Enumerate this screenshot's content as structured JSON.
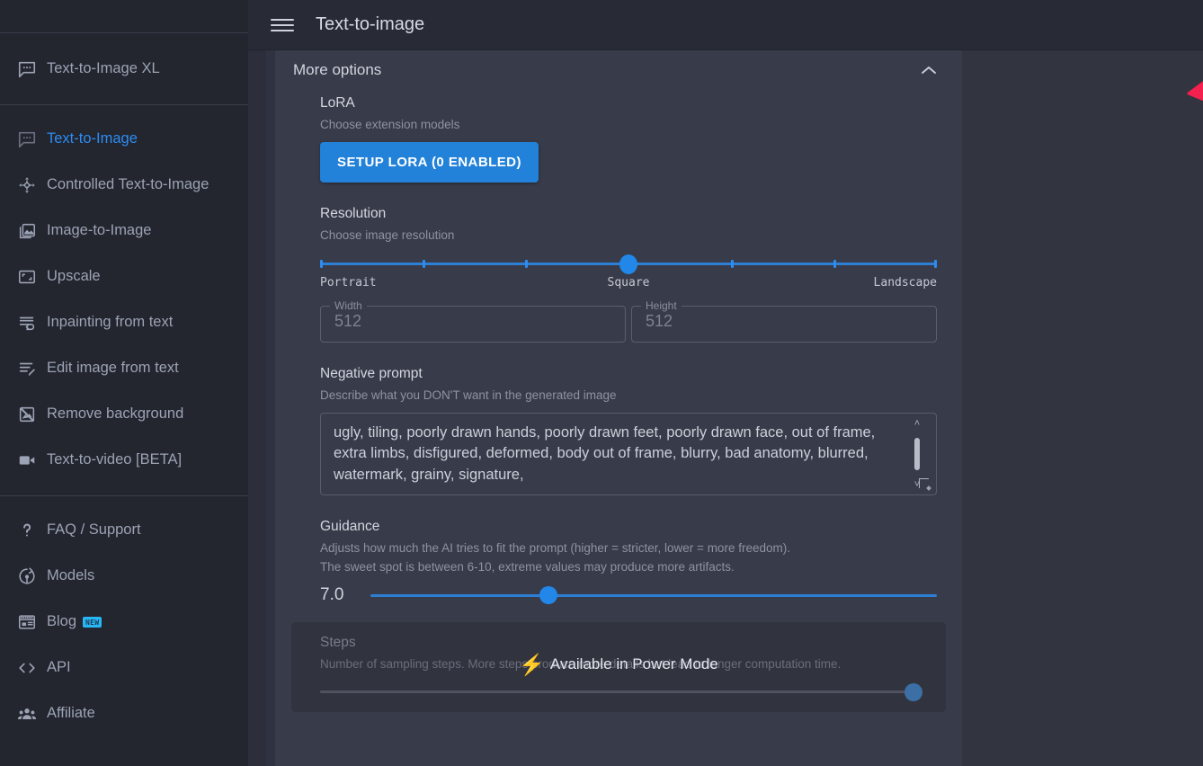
{
  "topbar": {
    "menu_icon": "hamburger-menu-icon",
    "title": "Text-to-image"
  },
  "sidebar": {
    "groups": [
      {
        "items": [
          {
            "label": "Text-to-Image XL",
            "icon": "chat-bubble-icon",
            "active": false
          }
        ]
      },
      {
        "items": [
          {
            "label": "Text-to-Image",
            "icon": "chat-bubble-icon",
            "active": true
          },
          {
            "label": "Controlled Text-to-Image",
            "icon": "control-move-icon",
            "active": false
          },
          {
            "label": "Image-to-Image",
            "icon": "images-icon",
            "active": false
          },
          {
            "label": "Upscale",
            "icon": "upscale-icon",
            "active": false
          },
          {
            "label": "Inpainting from text",
            "icon": "inpainting-icon",
            "active": false
          },
          {
            "label": "Edit image from text",
            "icon": "edit-text-icon",
            "active": false
          },
          {
            "label": "Remove background",
            "icon": "remove-background-icon",
            "active": false
          },
          {
            "label": "Text-to-video [BETA]",
            "icon": "video-camera-icon",
            "active": false
          }
        ]
      },
      {
        "items": [
          {
            "label": "FAQ / Support",
            "icon": "question-mark-icon",
            "active": false
          },
          {
            "label": "Models",
            "icon": "models-icon",
            "active": false
          },
          {
            "label": "Blog",
            "icon": "blog-icon",
            "active": false,
            "badge": "NEW"
          },
          {
            "label": "API",
            "icon": "code-brackets-icon",
            "active": false
          },
          {
            "label": "Affiliate",
            "icon": "people-group-icon",
            "active": false
          }
        ]
      }
    ]
  },
  "panel": {
    "section_title": "More options",
    "collapse_icon": "chevron-up-icon",
    "lora": {
      "label": "LoRA",
      "description": "Choose extension models",
      "button_label": "SETUP LORA (0 ENABLED)"
    },
    "resolution": {
      "label": "Resolution",
      "description": "Choose image resolution",
      "min_label": "Portrait",
      "mid_label": "Square",
      "max_label": "Landscape",
      "value_percent": 50,
      "tick_percents": [
        0,
        16.6,
        33.3,
        50,
        66.6,
        83.3,
        100
      ],
      "width_label": "Width",
      "width_value": "512",
      "height_label": "Height",
      "height_value": "512"
    },
    "negative_prompt": {
      "label": "Negative prompt",
      "description": "Describe what you DON'T want in the generated image",
      "value": "ugly, tiling, poorly drawn hands, poorly drawn feet, poorly drawn face, out of frame, extra limbs, disfigured, deformed, body out of frame, blurry, bad anatomy, blurred, watermark, grainy, signature,"
    },
    "guidance": {
      "label": "Guidance",
      "description_line1": "Adjusts how much the AI tries to fit the prompt (higher = stricter, lower = more freedom).",
      "description_line2": "The sweet spot is between 6-10, extreme values may produce more artifacts.",
      "value": "7.0",
      "value_percent": 31.5
    },
    "steps": {
      "label": "Steps",
      "description": "Number of sampling steps. More steps produce more details but lead to longer computation time.",
      "overlay_text": "Available in Power Mode",
      "overlay_icon": "lightning-bolt-icon",
      "value_percent": 96,
      "disabled": true
    }
  },
  "annotation": {
    "arrow_color": "#f4204e",
    "points_at": "collapse-chevron"
  },
  "colors": {
    "accent_blue": "#2287e8",
    "sidebar_bg": "#23252f",
    "panel_bg": "#383b49",
    "topbar_bg": "#282a36",
    "badge_blue": "#29b6f6"
  }
}
